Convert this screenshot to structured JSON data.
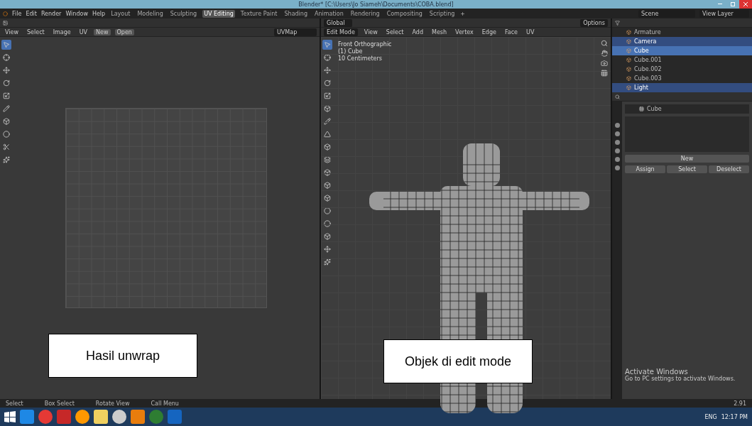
{
  "window": {
    "title": "Blender* [C:\\Users\\Jo Siameh\\Documents\\COBA.blend]"
  },
  "menu": [
    "File",
    "Edit",
    "Render",
    "Window",
    "Help"
  ],
  "workspaces": [
    {
      "label": "Layout",
      "selected": false
    },
    {
      "label": "Modeling",
      "selected": false
    },
    {
      "label": "Sculpting",
      "selected": false
    },
    {
      "label": "UV Editing",
      "selected": true
    },
    {
      "label": "Texture Paint",
      "selected": false
    },
    {
      "label": "Shading",
      "selected": false
    },
    {
      "label": "Animation",
      "selected": false
    },
    {
      "label": "Rendering",
      "selected": false
    },
    {
      "label": "Compositing",
      "selected": false
    },
    {
      "label": "Scripting",
      "selected": false
    }
  ],
  "scene": "Scene",
  "view_layer": "View Layer",
  "uv_editor": {
    "menu": [
      "View",
      "Select",
      "Image",
      "UV"
    ],
    "new_button": "New",
    "open_button": "Open",
    "uv_map": "UVMap",
    "caption": "Hasil unwrap",
    "tools": [
      {
        "selected": true
      },
      {
        "selected": false
      },
      {
        "selected": false
      },
      {
        "selected": false
      },
      {
        "selected": false
      },
      {
        "selected": false
      },
      {
        "selected": false
      },
      {
        "selected": false
      },
      {
        "selected": false
      },
      {
        "selected": false
      }
    ]
  },
  "viewport": {
    "mode": "Edit Mode",
    "menu": [
      "View",
      "Select",
      "Add",
      "Mesh",
      "Vertex",
      "Edge",
      "Face",
      "UV"
    ],
    "transform": "Global",
    "options": "Options",
    "info": [
      "Front Orthographic",
      "(1) Cube",
      "10 Centimeters"
    ],
    "caption": "Objek di edit mode",
    "tools": [
      {
        "selected": true
      },
      {
        "selected": false
      },
      {
        "selected": false
      },
      {
        "selected": false
      },
      {
        "selected": false
      },
      {
        "selected": false
      },
      {
        "selected": false
      },
      {
        "selected": false
      },
      {
        "selected": false
      },
      {
        "selected": false
      },
      {
        "selected": false
      },
      {
        "selected": false
      },
      {
        "selected": false
      },
      {
        "selected": false
      },
      {
        "selected": false
      },
      {
        "selected": false
      },
      {
        "selected": false
      },
      {
        "selected": false
      }
    ]
  },
  "outliner": {
    "items": [
      {
        "name": "Armature",
        "selected": false,
        "active": false
      },
      {
        "name": "Camera",
        "selected": true,
        "active": false
      },
      {
        "name": "Cube",
        "selected": true,
        "active": true
      },
      {
        "name": "Cube.001",
        "selected": false,
        "active": false
      },
      {
        "name": "Cube.002",
        "selected": false,
        "active": false
      },
      {
        "name": "Cube.003",
        "selected": false,
        "active": false
      },
      {
        "name": "Light",
        "selected": true,
        "active": false
      }
    ]
  },
  "properties": {
    "group": "Cube",
    "new_button": "New",
    "buttons": [
      "Assign",
      "Select",
      "Deselect"
    ]
  },
  "activation": {
    "title": "Activate Windows",
    "text": "Go to PC settings to activate Windows."
  },
  "status_bar": [
    "Select",
    "Box Select",
    "Rotate View",
    "Call Menu"
  ],
  "version": "2.91",
  "taskbar": {
    "language": "ENG",
    "time": "12:17 PM"
  }
}
